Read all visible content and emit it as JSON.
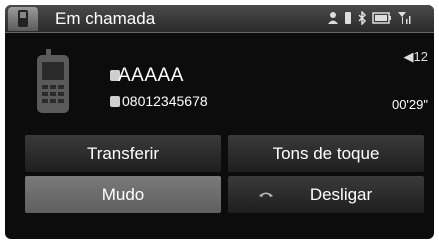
{
  "header": {
    "title": "Em chamada"
  },
  "call": {
    "name": "AAAAA",
    "number": "08012345678",
    "duration": "00'29\"",
    "volume": "12"
  },
  "buttons": {
    "transfer": "Transferir",
    "ringtones": "Tons de toque",
    "mute": "Mudo",
    "hangup": "Desligar"
  },
  "colors": {
    "background": "#0c0c0c",
    "active_button": "#6e6e6e",
    "text": "#ffffff"
  },
  "icons": [
    "phone-tab-icon",
    "bluetooth-icon",
    "battery-icon",
    "signal-icon",
    "mobile-phone-icon",
    "contact-icon",
    "number-icon",
    "volume-icon",
    "hang-up-icon"
  ]
}
